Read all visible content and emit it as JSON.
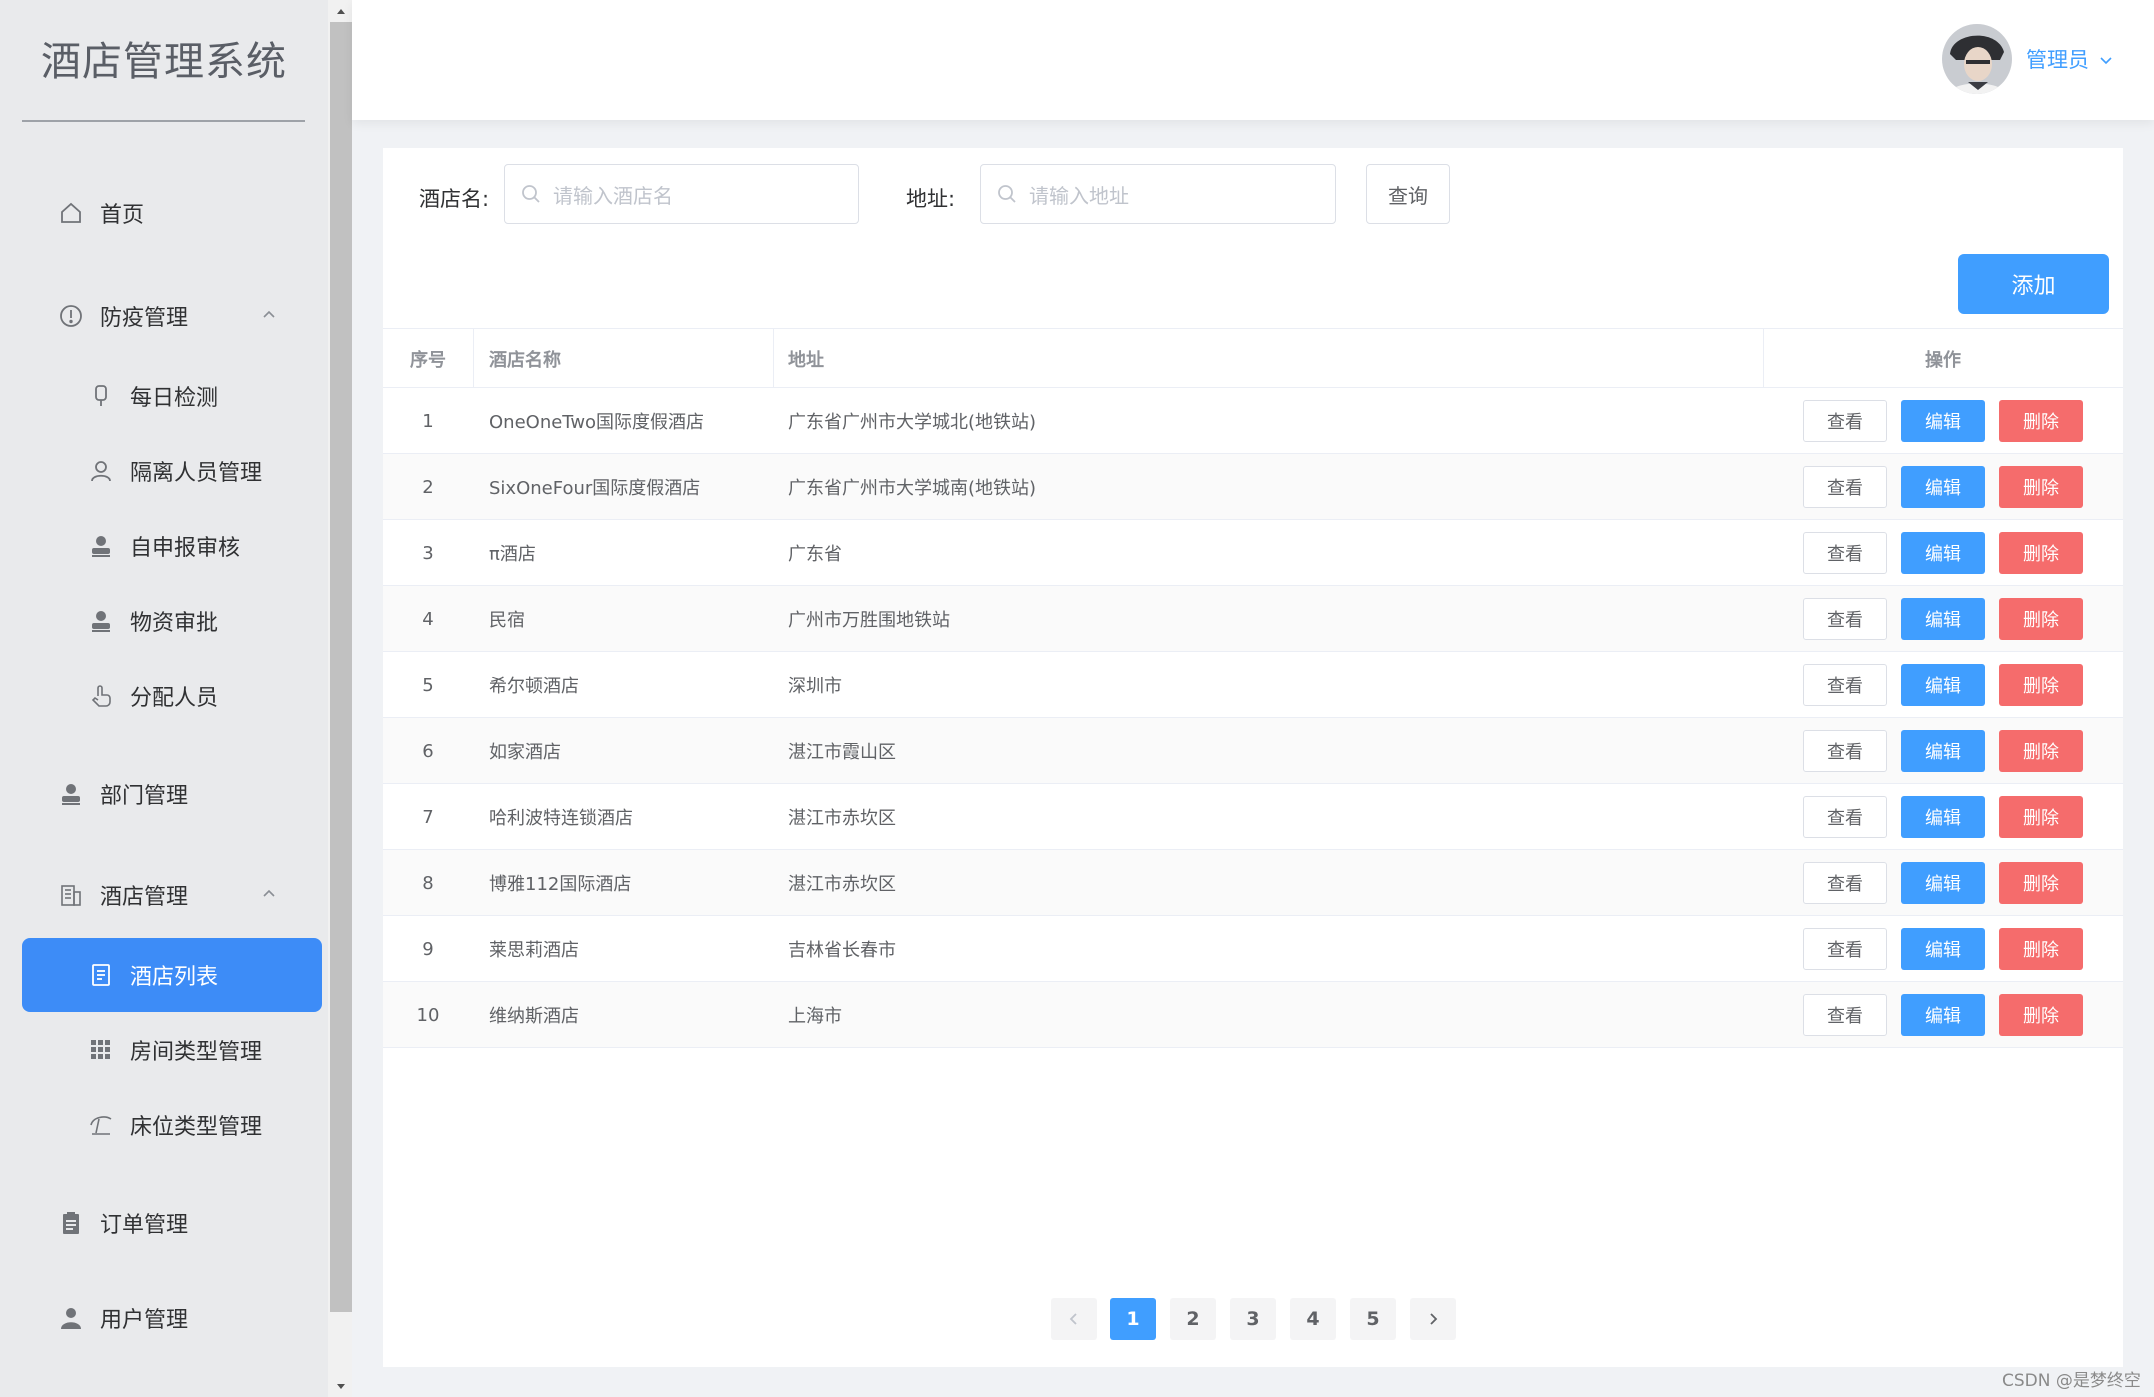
{
  "app": {
    "title": "酒店管理系统"
  },
  "sidebar": {
    "items": [
      {
        "label": "首页",
        "icon": "home-icon"
      },
      {
        "label": "防疫管理",
        "icon": "warning-circle-icon",
        "expanded": true
      },
      {
        "label": "每日检测",
        "icon": "thermometer-icon"
      },
      {
        "label": "隔离人员管理",
        "icon": "user-outline-icon"
      },
      {
        "label": "自申报审核",
        "icon": "user-solid-icon"
      },
      {
        "label": "物资审批",
        "icon": "user-solid-icon"
      },
      {
        "label": "分配人员",
        "icon": "hand-pointer-icon"
      },
      {
        "label": "部门管理",
        "icon": "user-solid-icon"
      },
      {
        "label": "酒店管理",
        "icon": "building-icon",
        "expanded": true
      },
      {
        "label": "酒店列表",
        "icon": "document-icon",
        "active": true
      },
      {
        "label": "房间类型管理",
        "icon": "grid-icon"
      },
      {
        "label": "床位类型管理",
        "icon": "umbrella-icon"
      },
      {
        "label": "订单管理",
        "icon": "clipboard-icon"
      },
      {
        "label": "用户管理",
        "icon": "user-solid-icon"
      }
    ]
  },
  "header": {
    "user_name": "管理员"
  },
  "search": {
    "hotel_label": "酒店名:",
    "hotel_placeholder": "请输入酒店名",
    "address_label": "地址:",
    "address_placeholder": "请输入地址",
    "query_label": "查询",
    "add_label": "添加"
  },
  "table": {
    "columns": [
      "序号",
      "酒店名称",
      "地址",
      "操作"
    ],
    "actions": {
      "view": "查看",
      "edit": "编辑",
      "delete": "删除"
    },
    "rows": [
      {
        "no": "1",
        "name": "OneOneTwo国际度假酒店",
        "address": "广东省广州市大学城北(地铁站)"
      },
      {
        "no": "2",
        "name": "SixOneFour国际度假酒店",
        "address": "广东省广州市大学城南(地铁站)"
      },
      {
        "no": "3",
        "name": "π酒店",
        "address": "广东省"
      },
      {
        "no": "4",
        "name": "民宿",
        "address": "广州市万胜围地铁站"
      },
      {
        "no": "5",
        "name": "希尔顿酒店",
        "address": "深圳市"
      },
      {
        "no": "6",
        "name": "如家酒店",
        "address": "湛江市霞山区"
      },
      {
        "no": "7",
        "name": "哈利波特连锁酒店",
        "address": "湛江市赤坎区"
      },
      {
        "no": "8",
        "name": "博雅112国际酒店",
        "address": "湛江市赤坎区"
      },
      {
        "no": "9",
        "name": "莱思莉酒店",
        "address": "吉林省长春市"
      },
      {
        "no": "10",
        "name": "维纳斯酒店",
        "address": "上海市"
      }
    ]
  },
  "pagination": {
    "pages": [
      "1",
      "2",
      "3",
      "4",
      "5"
    ],
    "current": "1"
  },
  "watermark": "CSDN @是梦终空",
  "colors": {
    "primary": "#409eff",
    "danger": "#f56c6c",
    "active_menu": "#3d8cf7"
  }
}
